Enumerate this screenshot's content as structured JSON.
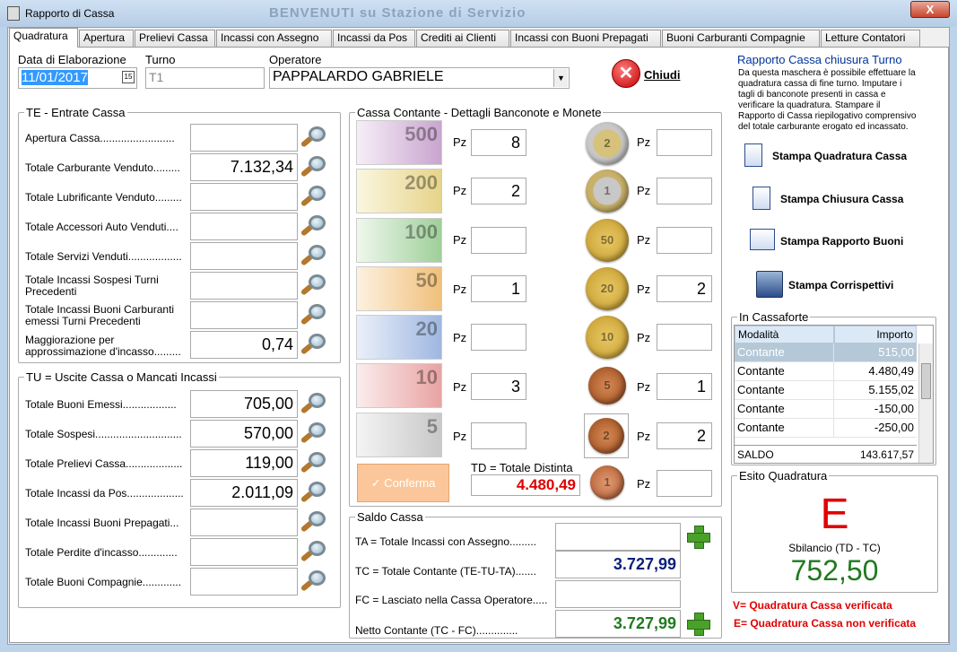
{
  "window": {
    "title": "Rapporto di Cassa",
    "bg_title": "BENVENUTI su Stazione di Servizio",
    "close": "X"
  },
  "tabs": [
    "Quadratura",
    "Apertura",
    "Prelievi Cassa",
    "Incassi con Assegno",
    "Incassi da Pos",
    "Crediti ai Clienti",
    "Incassi con Buoni Prepagati",
    "Buoni Carburanti Compagnie",
    "Letture Contatori"
  ],
  "header": {
    "data_label": "Data di Elaborazione",
    "data_value": "11/01/2017",
    "turno_label": "Turno",
    "turno_value": "T1",
    "operatore_label": "Operatore",
    "operatore_value": "PAPPALARDO GABRIELE",
    "chiudi": "Chiudi"
  },
  "te": {
    "title": "TE - Entrate Cassa",
    "rows": [
      {
        "label": "Apertura Cassa.........................",
        "value": ""
      },
      {
        "label": "Totale Carburante Venduto.........",
        "value": "7.132,34"
      },
      {
        "label": "Totale Lubrificante Venduto.........",
        "value": ""
      },
      {
        "label": "Totale Accessori Auto Venduti....",
        "value": ""
      },
      {
        "label": "Totale Servizi Venduti..................",
        "value": ""
      },
      {
        "label": "Totale Incassi Sospesi Turni",
        "label2": "Precedenti",
        "value": ""
      },
      {
        "label": "Totale Incassi Buoni Carburanti",
        "label2": "emessi Turni Precedenti",
        "value": ""
      },
      {
        "label": "Maggiorazione per",
        "label2": "approssimazione d'incasso.........",
        "value": "0,74"
      }
    ]
  },
  "tu": {
    "title": "TU = Uscite Cassa o Mancati Incassi",
    "rows": [
      {
        "label": "Totale Buoni Emessi..................",
        "value": "705,00"
      },
      {
        "label": "Totale Sospesi.............................",
        "value": "570,00"
      },
      {
        "label": "Totale Prelievi Cassa...................",
        "value": "119,00"
      },
      {
        "label": "Totale Incassi da Pos...................",
        "value": "2.011,09"
      },
      {
        "label": "Totale Incassi Buoni Prepagati...",
        "value": ""
      },
      {
        "label": "Totale Perdite d'incasso.............",
        "value": ""
      },
      {
        "label": "Totale Buoni Compagnie.............",
        "value": ""
      }
    ]
  },
  "cassa": {
    "title": "Cassa Contante - Dettagli Banconote e Monete",
    "pz": "Pz",
    "notes": [
      {
        "den": "500",
        "qty": "8",
        "color": "#c9a5cf"
      },
      {
        "den": "200",
        "qty": "2",
        "color": "#e6d48a"
      },
      {
        "den": "100",
        "qty": "",
        "color": "#9fcf9a"
      },
      {
        "den": "50",
        "qty": "1",
        "color": "#f0c07a"
      },
      {
        "den": "20",
        "qty": "",
        "color": "#9fb7e0"
      },
      {
        "den": "10",
        "qty": "3",
        "color": "#e8a3a3"
      },
      {
        "den": "5",
        "qty": "",
        "color": "#c8c8c8"
      }
    ],
    "coins": [
      {
        "den": "2",
        "qty": "",
        "color": "#d6c27a"
      },
      {
        "den": "1",
        "qty": "",
        "color": "#c9b16a"
      },
      {
        "den": "50",
        "qty": "",
        "color": "#d8b24a"
      },
      {
        "den": "20",
        "qty": "2",
        "color": "#d8b24a"
      },
      {
        "den": "10",
        "qty": "",
        "color": "#d8b24a"
      },
      {
        "den": "5",
        "qty": "1",
        "color": "#b8652e"
      },
      {
        "den": "2",
        "qty": "2",
        "color": "#b8652e"
      },
      {
        "den": "1",
        "qty": "",
        "color": "#c27a50"
      }
    ],
    "conferma": "Conferma",
    "td_label": "TD = Totale Distinta",
    "td_value": "4.480,49"
  },
  "saldo": {
    "title": "Saldo Cassa",
    "ta_label": "TA = Totale Incassi con Assegno.........",
    "ta_value": "",
    "tc_label": "TC = Totale Contante (TE-TU-TA).......",
    "tc_value": "3.727,99",
    "fc_label": "FC = Lasciato nella Cassa Operatore.....",
    "fc_value": "",
    "netto_label": "Netto Contante (TC - FC)..............",
    "netto_value": "3.727,99"
  },
  "right": {
    "title": "Rapporto Cassa chiusura Turno",
    "note": [
      "Da questa maschera è possibile effettuare la",
      "quadratura cassa di fine turno. Imputare i",
      "tagli di banconote presenti in cassa e",
      "verificare la quadratura. Stampare il",
      "Rapporto di Cassa riepilogativo comprensivo",
      "del totale carburante erogato ed incassato."
    ],
    "btn1": "Stampa Quadratura Cassa",
    "btn2": "Stampa Chiusura Cassa",
    "btn3": "Stampa Rapporto Buoni",
    "btn4": "Stampa Corrispettivi"
  },
  "cassaforte": {
    "title": "In Cassaforte",
    "col1": "Modalità",
    "col2": "Importo",
    "rows": [
      [
        "Contante",
        "515,00"
      ],
      [
        "Contante",
        "4.480,49"
      ],
      [
        "Contante",
        "5.155,02"
      ],
      [
        "Contante",
        "-150,00"
      ],
      [
        "Contante",
        "-250,00"
      ]
    ],
    "saldo_label": "SALDO",
    "saldo_value": "143.617,57"
  },
  "esito": {
    "title": "Esito Quadratura",
    "letter": "E",
    "sbilancio_label": "Sbilancio (TD - TC)",
    "sbilancio_value": "752,50",
    "legend_v": "V= Quadratura Cassa verificata",
    "legend_e": "E= Quadratura Cassa non verificata"
  },
  "colors": {
    "red": "#e00000",
    "green": "#1f7a1f",
    "navy": "#0a1f7a",
    "accent": "#003399"
  }
}
